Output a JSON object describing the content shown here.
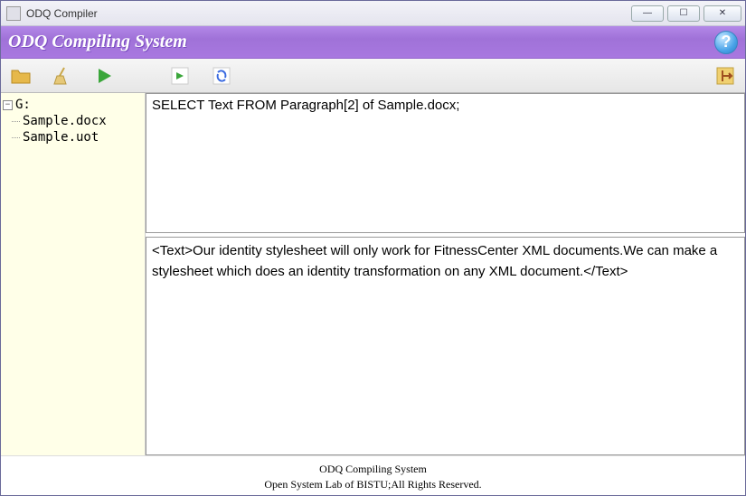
{
  "window": {
    "title": "ODQ Compiler",
    "minimize_glyph": "—",
    "maximize_glyph": "☐",
    "close_glyph": "✕"
  },
  "banner": {
    "title": "ODQ Compiling System",
    "help_glyph": "?"
  },
  "toolbar": {
    "icons": {
      "folder": "folder-icon",
      "clean": "broom-icon",
      "run": "play-icon",
      "next": "arrow-right-icon",
      "refresh": "refresh-icon",
      "exit": "exit-icon"
    }
  },
  "tree": {
    "root_label": "G:",
    "items": [
      {
        "label": "Sample.docx"
      },
      {
        "label": "Sample.uot"
      }
    ]
  },
  "query": {
    "text": "SELECT Text FROM Paragraph[2] of Sample.docx;"
  },
  "output": {
    "text": "<Text>Our identity stylesheet will only work for FitnessCenter XML documents.We can make a stylesheet which does an identity transformation on any XML document.</Text>"
  },
  "footer": {
    "line1": "ODQ Compiling System",
    "line2": "Open System Lab of BISTU;All Rights Reserved."
  }
}
